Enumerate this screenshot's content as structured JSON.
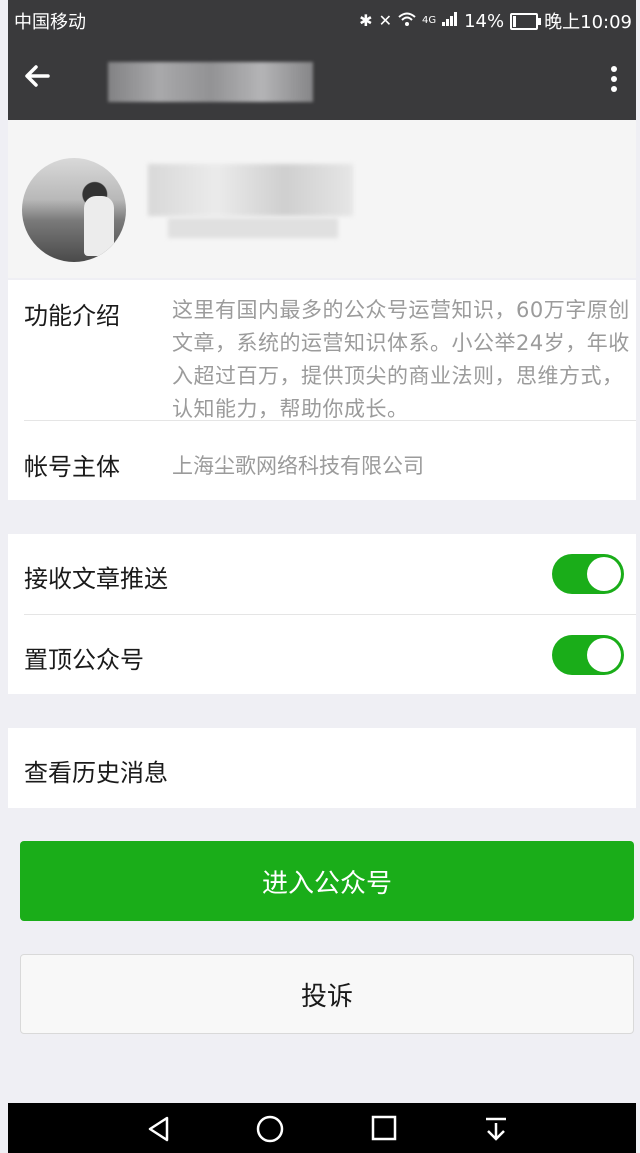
{
  "status_bar": {
    "carrier": "中国移动",
    "network": "4G",
    "battery": "14%",
    "battery_level": 0.14,
    "time": "晚上10:09"
  },
  "title_bar": {
    "back_icon": "back-arrow-icon",
    "more_icon": "more-vertical-icon"
  },
  "info": {
    "intro_label": "功能介绍",
    "intro_text": "这里有国内最多的公众号运营知识，60万字原创文章，系统的运营知识体系。小公举24岁，年收入超过百万，提供顶尖的商业法则，思维方式，认知能力，帮助你成长。",
    "account_label": "帐号主体",
    "account_value": "上海尘歌网络科技有限公司"
  },
  "settings": {
    "receive_push_label": "接收文章推送",
    "receive_push_on": true,
    "pin_top_label": "置顶公众号",
    "pin_top_on": true
  },
  "history": {
    "label": "查看历史消息"
  },
  "buttons": {
    "enter_label": "进入公众号",
    "complain_label": "投诉"
  },
  "colors": {
    "accent_green": "#1aad19",
    "header_dark": "#3a3a3c"
  }
}
